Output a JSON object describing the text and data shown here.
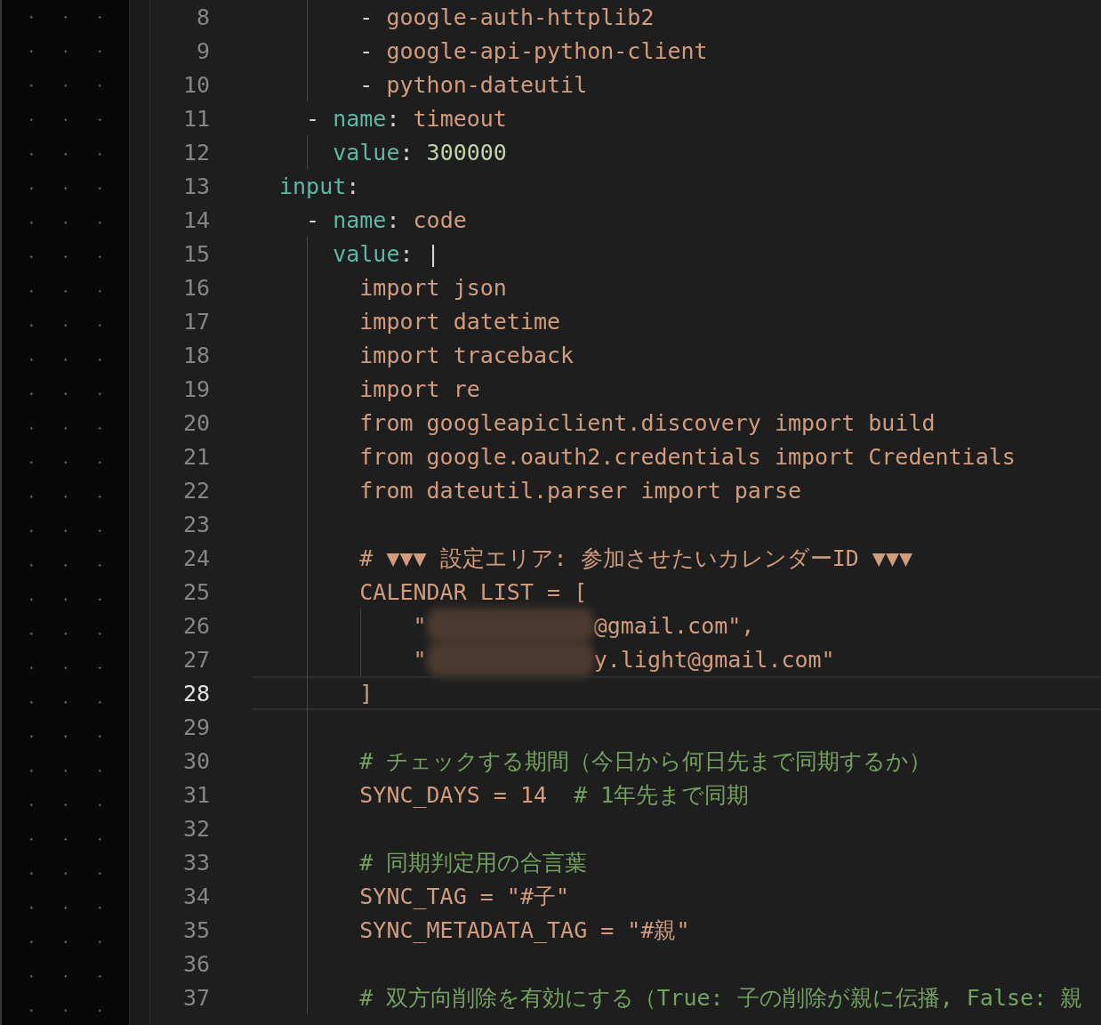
{
  "editor": {
    "lines": [
      {
        "number": "8",
        "current": false,
        "segments": [
          {
            "kind": "dash",
            "text": "      - "
          },
          {
            "kind": "string",
            "text": "google-auth-httplib2"
          }
        ]
      },
      {
        "number": "9",
        "current": false,
        "segments": [
          {
            "kind": "dash",
            "text": "      - "
          },
          {
            "kind": "string",
            "text": "google-api-python-client"
          }
        ]
      },
      {
        "number": "10",
        "current": false,
        "segments": [
          {
            "kind": "dash",
            "text": "      - "
          },
          {
            "kind": "string",
            "text": "python-dateutil"
          }
        ]
      },
      {
        "number": "11",
        "current": false,
        "segments": [
          {
            "kind": "dash",
            "text": "  - "
          },
          {
            "kind": "key",
            "text": "name"
          },
          {
            "kind": "punct",
            "text": ": "
          },
          {
            "kind": "string",
            "text": "timeout"
          }
        ]
      },
      {
        "number": "12",
        "current": false,
        "segments": [
          {
            "kind": "key",
            "text": "    value"
          },
          {
            "kind": "punct",
            "text": ": "
          },
          {
            "kind": "number",
            "text": "300000"
          }
        ]
      },
      {
        "number": "13",
        "current": false,
        "segments": [
          {
            "kind": "key",
            "text": "input"
          },
          {
            "kind": "punct",
            "text": ":"
          }
        ]
      },
      {
        "number": "14",
        "current": false,
        "segments": [
          {
            "kind": "dash",
            "text": "  - "
          },
          {
            "kind": "key",
            "text": "name"
          },
          {
            "kind": "punct",
            "text": ": "
          },
          {
            "kind": "string",
            "text": "code"
          }
        ]
      },
      {
        "number": "15",
        "current": false,
        "segments": [
          {
            "kind": "key",
            "text": "    value"
          },
          {
            "kind": "punct",
            "text": ": |"
          }
        ]
      },
      {
        "number": "16",
        "current": false,
        "segments": [
          {
            "kind": "string",
            "text": "      import json"
          }
        ]
      },
      {
        "number": "17",
        "current": false,
        "segments": [
          {
            "kind": "string",
            "text": "      import datetime"
          }
        ]
      },
      {
        "number": "18",
        "current": false,
        "segments": [
          {
            "kind": "string",
            "text": "      import traceback"
          }
        ]
      },
      {
        "number": "19",
        "current": false,
        "segments": [
          {
            "kind": "string",
            "text": "      import re"
          }
        ]
      },
      {
        "number": "20",
        "current": false,
        "segments": [
          {
            "kind": "string",
            "text": "      from googleapiclient.discovery import build"
          }
        ]
      },
      {
        "number": "21",
        "current": false,
        "segments": [
          {
            "kind": "string",
            "text": "      from google.oauth2.credentials import Credentials"
          }
        ]
      },
      {
        "number": "22",
        "current": false,
        "segments": [
          {
            "kind": "string",
            "text": "      from dateutil.parser import parse"
          }
        ]
      },
      {
        "number": "23",
        "current": false
      },
      {
        "number": "24",
        "current": false,
        "segments": [
          {
            "kind": "string",
            "text": "      # ▼▼▼ 設定エリア: 参加させたいカレンダーID ▼▼▼"
          }
        ]
      },
      {
        "number": "25",
        "current": false,
        "segments": [
          {
            "kind": "string",
            "text": "      CALENDAR LIST = ["
          }
        ]
      },
      {
        "number": "26",
        "current": false,
        "segments": [
          {
            "kind": "string",
            "text": "          \""
          },
          {
            "kind": "redacted"
          },
          {
            "kind": "string",
            "text": "@gmail.com\","
          }
        ]
      },
      {
        "number": "27",
        "current": false,
        "segments": [
          {
            "kind": "string",
            "text": "          \""
          },
          {
            "kind": "redacted"
          },
          {
            "kind": "string",
            "text": "y.light@gmail.com\""
          }
        ]
      },
      {
        "number": "28",
        "current": true,
        "segments": [
          {
            "kind": "string",
            "text": "      ]"
          }
        ]
      },
      {
        "number": "29",
        "current": false
      },
      {
        "number": "30",
        "current": false,
        "segments": [
          {
            "kind": "comment",
            "text": "      # チェックする期間（今日から何日先まで同期するか）"
          }
        ]
      },
      {
        "number": "31",
        "current": false,
        "segments": [
          {
            "kind": "string",
            "text": "      SYNC_DAYS = 14  "
          },
          {
            "kind": "comment",
            "text": "# 1年先まで同期"
          }
        ]
      },
      {
        "number": "32",
        "current": false
      },
      {
        "number": "33",
        "current": false,
        "segments": [
          {
            "kind": "comment",
            "text": "      # 同期判定用の合言葉"
          }
        ]
      },
      {
        "number": "34",
        "current": false,
        "segments": [
          {
            "kind": "string",
            "text": "      SYNC_TAG = \"#子\""
          }
        ]
      },
      {
        "number": "35",
        "current": false,
        "segments": [
          {
            "kind": "string",
            "text": "      SYNC_METADATA_TAG = \"#親\""
          }
        ]
      },
      {
        "number": "36",
        "current": false
      },
      {
        "number": "37",
        "current": false,
        "segments": [
          {
            "kind": "comment",
            "text": "      # 双方向削除を有効にする（True: 子の削除が親に伝播, False: 親"
          }
        ]
      }
    ]
  }
}
